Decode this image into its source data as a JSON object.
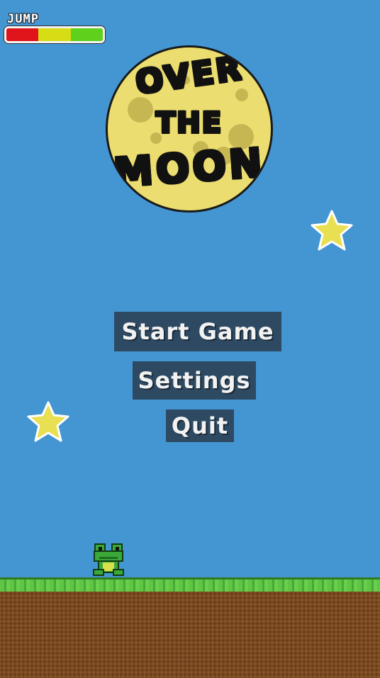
{
  "hud": {
    "jump_label": "JUMP",
    "jump_meter_colors": [
      "#e0141b",
      "#d6dd14",
      "#5fd11c"
    ]
  },
  "title": {
    "line1": "OVER",
    "line2": "THE",
    "line3": "MOON"
  },
  "menu": {
    "start_label": "Start Game",
    "settings_label": "Settings",
    "quit_label": "Quit"
  },
  "colors": {
    "sky": "#4496d2",
    "moon": "#ebdd6f",
    "button_bg": "#2e4a63",
    "star": "#e8df52"
  },
  "icons": {
    "player": "frog-icon",
    "decor": "star-icon"
  }
}
